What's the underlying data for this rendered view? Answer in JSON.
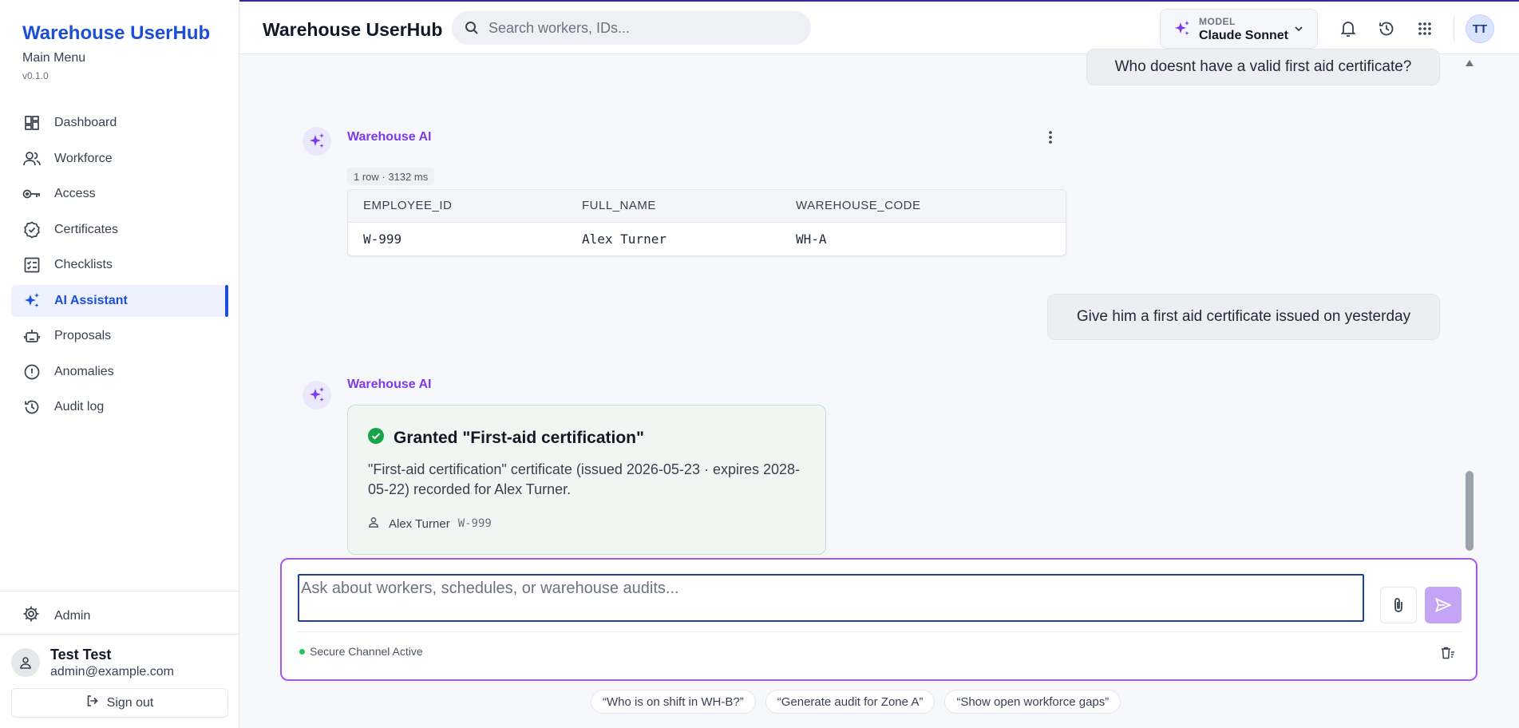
{
  "sidebar": {
    "brand": "Warehouse UserHub",
    "subtitle": "Main Menu",
    "version": "v0.1.0",
    "items": [
      {
        "label": "Dashboard",
        "icon": "dashboard-icon"
      },
      {
        "label": "Workforce",
        "icon": "users-icon"
      },
      {
        "label": "Access",
        "icon": "key-icon"
      },
      {
        "label": "Certificates",
        "icon": "certificate-icon"
      },
      {
        "label": "Checklists",
        "icon": "checklist-icon"
      },
      {
        "label": "AI Assistant",
        "icon": "sparkle-icon",
        "active": true
      },
      {
        "label": "Proposals",
        "icon": "robot-icon"
      },
      {
        "label": "Anomalies",
        "icon": "alert-icon"
      },
      {
        "label": "Audit log",
        "icon": "history-icon"
      }
    ],
    "admin_label": "Admin",
    "user": {
      "name": "Test Test",
      "email": "admin@example.com"
    },
    "signout_label": "Sign out"
  },
  "header": {
    "title": "Warehouse UserHub",
    "search_placeholder": "Search workers, IDs...",
    "model_label": "MODEL",
    "model_value": "Claude Sonnet",
    "avatar_initials": "TT"
  },
  "chat": {
    "user_message_1": "Who doesnt have a valid first aid certificate?",
    "ai_name": "Warehouse AI",
    "result_meta": "1 row · 3132 ms",
    "table": {
      "columns": [
        "EMPLOYEE_ID",
        "FULL_NAME",
        "WAREHOUSE_CODE"
      ],
      "rows": [
        [
          "W-999",
          "Alex Turner",
          "WH-A"
        ]
      ]
    },
    "user_message_2": "Give him a first aid certificate issued on yesterday",
    "grant": {
      "title": "Granted \"First-aid certification\"",
      "body": "\"First-aid certification\" certificate (issued 2026-05-23 · expires 2028-05-22) recorded for Alex Turner.",
      "person_name": "Alex Turner",
      "person_id": "W-999"
    }
  },
  "composer": {
    "placeholder": "Ask about workers, schedules, or warehouse audits...",
    "status": "Secure Channel Active"
  },
  "suggestions": [
    "“Who is on shift in WH-B?”",
    "“Generate audit for Zone A”",
    "“Show open workforce gaps”"
  ],
  "colors": {
    "brand": "#1d4ed8",
    "ai_accent": "#7c3aed",
    "success": "#16a34a",
    "composer_border": "#a855f7"
  }
}
